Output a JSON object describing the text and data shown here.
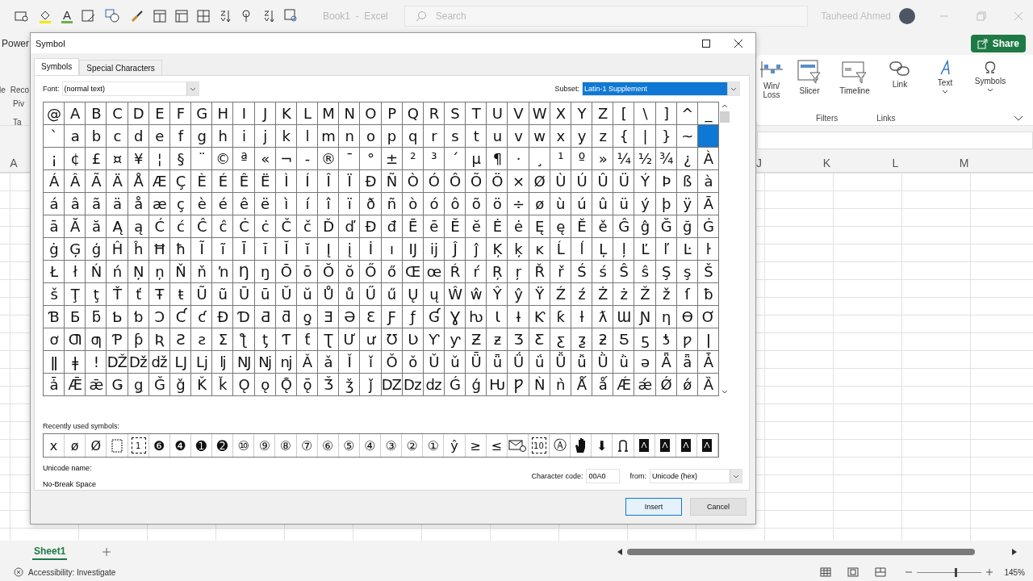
{
  "excel": {
    "font_color_label": "A",
    "doc_title": "Book1  -  Excel",
    "search": {
      "placeholder": "Search"
    },
    "user": "Tauheed Ahmed",
    "share": "Share",
    "ribbon_tab_fragment": "Power",
    "ribbon_left_fragments": [
      "le",
      "Reco",
      "Piv",
      "Ta"
    ],
    "ribbon_items": [
      {
        "label": "Win/ Loss",
        "kind": "winloss",
        "dropdown": false
      },
      {
        "label": "Slicer",
        "kind": "slicer",
        "dropdown": false
      },
      {
        "label": "Timeline",
        "kind": "timeline",
        "dropdown": false
      },
      {
        "label": "Link",
        "kind": "link",
        "dropdown": false
      },
      {
        "label": "Text",
        "kind": "text",
        "dropdown": true
      },
      {
        "label": "Symbols",
        "kind": "symbols",
        "dropdown": true
      }
    ],
    "ribbon_groups": [
      "Filters",
      "Links"
    ],
    "column_headers": [
      "A",
      "J",
      "K",
      "L",
      "M"
    ],
    "sheet_tabs": [
      {
        "label": "Sheet1",
        "selected": true
      }
    ],
    "status": "Accessibility: Investigate",
    "zoom": "145%",
    "zoom_slider": {
      "level": 0.6
    }
  },
  "dialog": {
    "title": "Symbol",
    "tabs": [
      {
        "label": "Symbols",
        "selected": true
      },
      {
        "label": "Special Characters",
        "selected": false
      }
    ],
    "font_label": "Font:",
    "font_value": "(normal text)",
    "subset_label": "Subset:",
    "subset_value": "Latin-1 Supplement",
    "grid": [
      [
        "@",
        "A",
        "B",
        "C",
        "D",
        "E",
        "F",
        "G",
        "H",
        "I",
        "J",
        "K",
        "L",
        "M",
        "N",
        "O",
        "P",
        "Q",
        "R",
        "S",
        "T",
        "U",
        "V",
        "W",
        "X",
        "Y",
        "Z",
        "[",
        "\\",
        "]",
        "^",
        "_"
      ],
      [
        "`",
        "a",
        "b",
        "c",
        "d",
        "e",
        "f",
        "g",
        "h",
        "i",
        "j",
        "k",
        "l",
        "m",
        "n",
        "o",
        "p",
        "q",
        "r",
        "s",
        "t",
        "u",
        "v",
        "w",
        "x",
        "y",
        "z",
        "{",
        "|",
        "}",
        "~",
        {
          "selected": true
        }
      ],
      [
        "¡",
        "¢",
        "£",
        "¤",
        "¥",
        "¦",
        "§",
        "¨",
        "©",
        "ª",
        "«",
        "¬",
        "-",
        "®",
        "¯",
        "°",
        "±",
        "²",
        "³",
        "´",
        "µ",
        "¶",
        "·",
        "¸",
        "¹",
        "º",
        "»",
        "¼",
        "½",
        "¾",
        "¿",
        "À"
      ],
      [
        "Á",
        "Â",
        "Ã",
        "Ä",
        "Å",
        "Æ",
        "Ç",
        "È",
        "É",
        "Ê",
        "Ë",
        "Ì",
        "Í",
        "Î",
        "Ï",
        "Ð",
        "Ñ",
        "Ò",
        "Ó",
        "Ô",
        "Õ",
        "Ö",
        "×",
        "Ø",
        "Ù",
        "Ú",
        "Û",
        "Ü",
        "Ý",
        "Þ",
        "ß",
        "à"
      ],
      [
        "á",
        "â",
        "ã",
        "ä",
        "å",
        "æ",
        "ç",
        "è",
        "é",
        "ê",
        "ë",
        "ì",
        "í",
        "î",
        "ï",
        "ð",
        "ñ",
        "ò",
        "ó",
        "ô",
        "õ",
        "ö",
        "÷",
        "ø",
        "ù",
        "ú",
        "û",
        "ü",
        "ý",
        "þ",
        "ÿ",
        "Ā"
      ],
      [
        "ā",
        "Ă",
        "ă",
        "Ą",
        "ą",
        "Ć",
        "ć",
        "Ĉ",
        "ĉ",
        "Ċ",
        "ċ",
        "Č",
        "č",
        "Ď",
        "ď",
        "Đ",
        "đ",
        "Ē",
        "ē",
        "Ĕ",
        "ĕ",
        "Ė",
        "ė",
        "Ę",
        "ę",
        "Ě",
        "ě",
        "Ĝ",
        "ĝ",
        "Ğ",
        "ğ",
        "Ġ"
      ],
      [
        "ġ",
        "Ģ",
        "ģ",
        "Ĥ",
        "ĥ",
        "Ħ",
        "ħ",
        "Ĩ",
        "ĩ",
        "Ī",
        "ī",
        "Ĭ",
        "ĭ",
        "Į",
        "į",
        "İ",
        "ı",
        "Ĳ",
        "ĳ",
        "Ĵ",
        "ĵ",
        "Ķ",
        "ķ",
        "ĸ",
        "Ĺ",
        "ĺ",
        "Ļ",
        "ļ",
        "Ľ",
        "ľ",
        "Ŀ",
        "ŀ"
      ],
      [
        "Ł",
        "ł",
        "Ń",
        "ń",
        "Ņ",
        "ņ",
        "Ň",
        "ň",
        "ŉ",
        "Ŋ",
        "ŋ",
        "Ō",
        "ō",
        "Ŏ",
        "ŏ",
        "Ő",
        "ő",
        "Œ",
        "œ",
        "Ŕ",
        "ŕ",
        "Ŗ",
        "ŗ",
        "Ř",
        "ř",
        "Ś",
        "ś",
        "Ŝ",
        "ŝ",
        "Ş",
        "ş",
        "Š"
      ],
      [
        "š",
        "Ţ",
        "ţ",
        "Ť",
        "ť",
        "Ŧ",
        "ŧ",
        "Ũ",
        "ũ",
        "Ū",
        "ū",
        "Ŭ",
        "ŭ",
        "Ů",
        "ů",
        "Ű",
        "ű",
        "Ų",
        "ų",
        "Ŵ",
        "ŵ",
        "Ŷ",
        "ŷ",
        "Ÿ",
        "Ź",
        "ź",
        "Ż",
        "ż",
        "Ž",
        "ž",
        "ſ",
        "ƀ"
      ],
      [
        "Ɓ",
        "Ƃ",
        "ƃ",
        "Ƅ",
        "ƅ",
        "Ɔ",
        "Ƈ",
        "ƈ",
        "Ɖ",
        "Ɗ",
        "Ƌ",
        "ƌ",
        "ƍ",
        "Ǝ",
        "Ə",
        "Ɛ",
        "Ƒ",
        "ƒ",
        "Ɠ",
        "Ɣ",
        "ƕ",
        "Ɩ",
        "Ɨ",
        "Ƙ",
        "ƙ",
        "ƚ",
        "ƛ",
        "Ɯ",
        "Ɲ",
        "ƞ",
        "Ɵ",
        "Ơ"
      ],
      [
        "ơ",
        "Ƣ",
        "ƣ",
        "Ƥ",
        "ƥ",
        "Ʀ",
        "Ƨ",
        "ƨ",
        "Ʃ",
        "ƪ",
        "ƫ",
        "Ƭ",
        "ƭ",
        "Ʈ",
        "Ư",
        "ư",
        "Ʊ",
        "Ʋ",
        "Ƴ",
        "ƴ",
        "Ƶ",
        "ƶ",
        "Ʒ",
        "Ƹ",
        "ƹ",
        "ƺ",
        "ƻ",
        "Ƽ",
        "ƽ",
        "ƾ",
        "ƿ",
        "ǀ"
      ],
      [
        "ǁ",
        "ǂ",
        "ǃ",
        "Ǆ",
        "ǅ",
        "ǆ",
        "Ǉ",
        "ǈ",
        "ǉ",
        "Ǌ",
        "ǋ",
        "ǌ",
        "Ǎ",
        "ǎ",
        "Ǐ",
        "ǐ",
        "Ǒ",
        "ǒ",
        "Ǔ",
        "ǔ",
        "Ǖ",
        "ǖ",
        "Ǘ",
        "ǘ",
        "Ǚ",
        "ǚ",
        "Ǜ",
        "ǜ",
        "ǝ",
        "Ǟ",
        "ǟ",
        "Ǡ"
      ],
      [
        "ǡ",
        "Ǣ",
        "ǣ",
        "Ǥ",
        "ǥ",
        "Ǧ",
        "ǧ",
        "Ǩ",
        "ǩ",
        "Ǫ",
        "ǫ",
        "Ǭ",
        "ǭ",
        "Ǯ",
        "ǯ",
        "ǰ",
        "Ǳ",
        "ǲ",
        "ǳ",
        "Ǵ",
        "ǵ",
        "Ƕ",
        "Ƿ",
        "Ǹ",
        "ǹ",
        "Ǻ",
        "ǻ",
        "Ǽ",
        "ǽ",
        "Ǿ",
        "ǿ",
        "Ȁ"
      ]
    ],
    "recent_label": "Recently used symbols:",
    "recent": [
      {
        "kind": "char",
        "text": "x"
      },
      {
        "kind": "char",
        "text": "ø"
      },
      {
        "kind": "char",
        "text": "Ø"
      },
      {
        "kind": "page"
      },
      {
        "kind": "page-number",
        "text": "1"
      },
      {
        "kind": "char",
        "text": "❻"
      },
      {
        "kind": "char",
        "text": "❹"
      },
      {
        "kind": "char",
        "text": "➊"
      },
      {
        "kind": "char",
        "text": "➋"
      },
      {
        "kind": "char",
        "text": "⑩"
      },
      {
        "kind": "char",
        "text": "⑨"
      },
      {
        "kind": "char",
        "text": "⑧"
      },
      {
        "kind": "char",
        "text": "⑦"
      },
      {
        "kind": "char",
        "text": "⑥"
      },
      {
        "kind": "char",
        "text": "⑤"
      },
      {
        "kind": "char",
        "text": "④"
      },
      {
        "kind": "char",
        "text": "③"
      },
      {
        "kind": "char",
        "text": "②"
      },
      {
        "kind": "char",
        "text": "①"
      },
      {
        "kind": "char",
        "text": "ŷ"
      },
      {
        "kind": "char",
        "text": "≥"
      },
      {
        "kind": "char",
        "text": "≤"
      },
      {
        "kind": "envelope"
      },
      {
        "kind": "boxed",
        "text": "10"
      },
      {
        "kind": "char",
        "text": "Ⓐ"
      },
      {
        "kind": "hand"
      },
      {
        "kind": "char",
        "text": "⬇"
      },
      {
        "kind": "bell"
      },
      {
        "kind": "glyph-box"
      },
      {
        "kind": "glyph-box"
      },
      {
        "kind": "glyph-box"
      },
      {
        "kind": "glyph-box"
      }
    ],
    "unicode_name_label": "Unicode name:",
    "unicode_name": "No-Break Space",
    "char_code_label": "Character code:",
    "char_code": "00A0",
    "from_label": "from:",
    "from_value": "Unicode (hex)",
    "buttons": [
      {
        "label": "Insert",
        "default": true
      },
      {
        "label": "Cancel",
        "default": false
      }
    ]
  }
}
